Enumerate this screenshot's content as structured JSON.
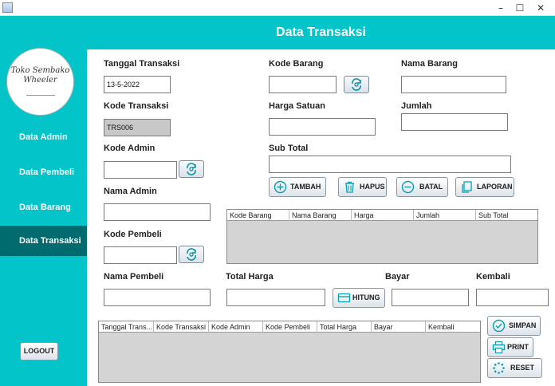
{
  "window": {
    "title": "",
    "minimize_glyph": "–",
    "maximize_glyph": "☐",
    "close_glyph": "✕"
  },
  "sidebar": {
    "logo_text": "Toko Sembako Wheeler",
    "items": [
      {
        "label": "Data Admin"
      },
      {
        "label": "Data Pembeli"
      },
      {
        "label": "Data Barang"
      },
      {
        "label": "Data Transaksi",
        "active": true
      }
    ],
    "logout_label": "LOGOUT"
  },
  "header": {
    "title": "Data Transaksi"
  },
  "form": {
    "tanggal_label": "Tanggal Transaksi",
    "tanggal_value": "13-5-2022",
    "kode_transaksi_label": "Kode Transaksi",
    "kode_transaksi_value": "TRS006",
    "kode_admin_label": "Kode Admin",
    "kode_admin_value": "",
    "nama_admin_label": "Nama Admin",
    "nama_admin_value": "",
    "kode_pembeli_label": "Kode Pembeli",
    "kode_pembeli_value": "",
    "nama_pembeli_label": "Nama Pembeli",
    "nama_pembeli_value": "",
    "kode_barang_label": "Kode Barang",
    "kode_barang_value": "",
    "nama_barang_label": "Nama Barang",
    "nama_barang_value": "",
    "harga_satuan_label": "Harga Satuan",
    "harga_satuan_value": "",
    "jumlah_label": "Jumlah",
    "jumlah_value": "",
    "sub_total_label": "Sub Total",
    "sub_total_value": "",
    "total_harga_label": "Total Harga",
    "total_harga_value": "",
    "bayar_label": "Bayar",
    "bayar_value": "",
    "kembali_label": "Kembali",
    "kembali_value": ""
  },
  "actions": {
    "tambah": "TAMBAH",
    "hapus": "HAPUS",
    "batal": "BATAL",
    "laporan": "LAPORAN",
    "hitung": "HITUNG",
    "simpan": "SIMPAN",
    "print": "PRINT",
    "reset": "RESET"
  },
  "item_table": {
    "columns": [
      "Kode Barang",
      "Nama Barang",
      "Harga",
      "Jumlah",
      "Sub Total"
    ],
    "rows": []
  },
  "transaction_table": {
    "columns": [
      "Tanggal Trans...",
      "Kode Transaksi",
      "Kode Admin",
      "Kode Pembeli",
      "Total Harga",
      "Bayar",
      "Kembali"
    ],
    "rows": []
  },
  "colors": {
    "accent": "#03c4c9",
    "sidebar_active": "#006b6f",
    "disabled_field": "#c8c8c8",
    "table_body": "#d4d4d4"
  }
}
